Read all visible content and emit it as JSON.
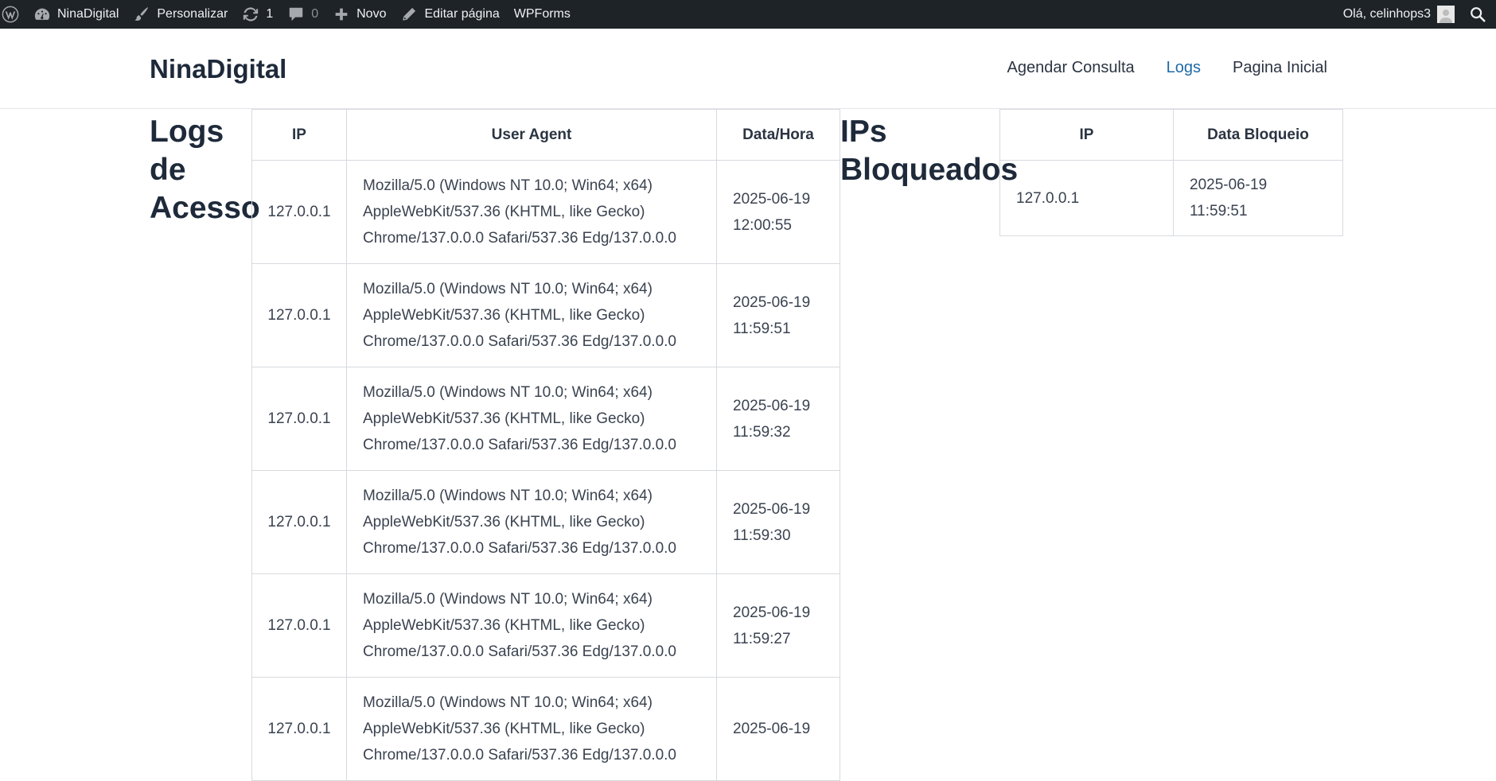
{
  "adminbar": {
    "site": "NinaDigital",
    "customize": "Personalizar",
    "updates": "1",
    "comments": "0",
    "new": "Novo",
    "edit_page": "Editar página",
    "wpforms": "WPForms",
    "greeting": "Olá, celinhops3"
  },
  "header": {
    "brand": "NinaDigital",
    "nav": [
      "Agendar Consulta",
      "Logs",
      "Pagina Inicial"
    ],
    "active_nav": "Logs"
  },
  "logs": {
    "title": "Logs de Acesso",
    "columns": [
      "IP",
      "User Agent",
      "Data/Hora"
    ],
    "rows": [
      {
        "ip": "127.0.0.1",
        "ua": "Mozilla/5.0 (Windows NT 10.0; Win64; x64) AppleWebKit/537.36 (KHTML, like Gecko) Chrome/137.0.0.0 Safari/537.36 Edg/137.0.0.0",
        "date": "2025-06-19",
        "time": "12:00:55"
      },
      {
        "ip": "127.0.0.1",
        "ua": "Mozilla/5.0 (Windows NT 10.0; Win64; x64) AppleWebKit/537.36 (KHTML, like Gecko) Chrome/137.0.0.0 Safari/537.36 Edg/137.0.0.0",
        "date": "2025-06-19",
        "time": "11:59:51"
      },
      {
        "ip": "127.0.0.1",
        "ua": "Mozilla/5.0 (Windows NT 10.0; Win64; x64) AppleWebKit/537.36 (KHTML, like Gecko) Chrome/137.0.0.0 Safari/537.36 Edg/137.0.0.0",
        "date": "2025-06-19",
        "time": "11:59:32"
      },
      {
        "ip": "127.0.0.1",
        "ua": "Mozilla/5.0 (Windows NT 10.0; Win64; x64) AppleWebKit/537.36 (KHTML, like Gecko) Chrome/137.0.0.0 Safari/537.36 Edg/137.0.0.0",
        "date": "2025-06-19",
        "time": "11:59:30"
      },
      {
        "ip": "127.0.0.1",
        "ua": "Mozilla/5.0 (Windows NT 10.0; Win64; x64) AppleWebKit/537.36 (KHTML, like Gecko) Chrome/137.0.0.0 Safari/537.36 Edg/137.0.0.0",
        "date": "2025-06-19",
        "time": "11:59:27"
      },
      {
        "ip": "127.0.0.1",
        "ua": "Mozilla/5.0 (Windows NT 10.0; Win64; x64) AppleWebKit/537.36 (KHTML, like Gecko) Chrome/137.0.0.0 Safari/537.36 Edg/137.0.0.0",
        "date": "2025-06-19",
        "time": ""
      }
    ]
  },
  "blocked": {
    "title": "IPs Bloqueados",
    "columns": [
      "IP",
      "Data Bloqueio"
    ],
    "rows": [
      {
        "ip": "127.0.0.1",
        "date": "2025-06-19",
        "time": "11:59:51"
      }
    ]
  },
  "icons": {
    "wordpress": "wordpress-icon",
    "dashboard": "dashboard-icon",
    "brush": "brush-icon",
    "updates": "refresh-icon",
    "comments": "comment-icon",
    "new": "plus-icon",
    "edit": "pencil-icon",
    "search": "search-icon"
  }
}
